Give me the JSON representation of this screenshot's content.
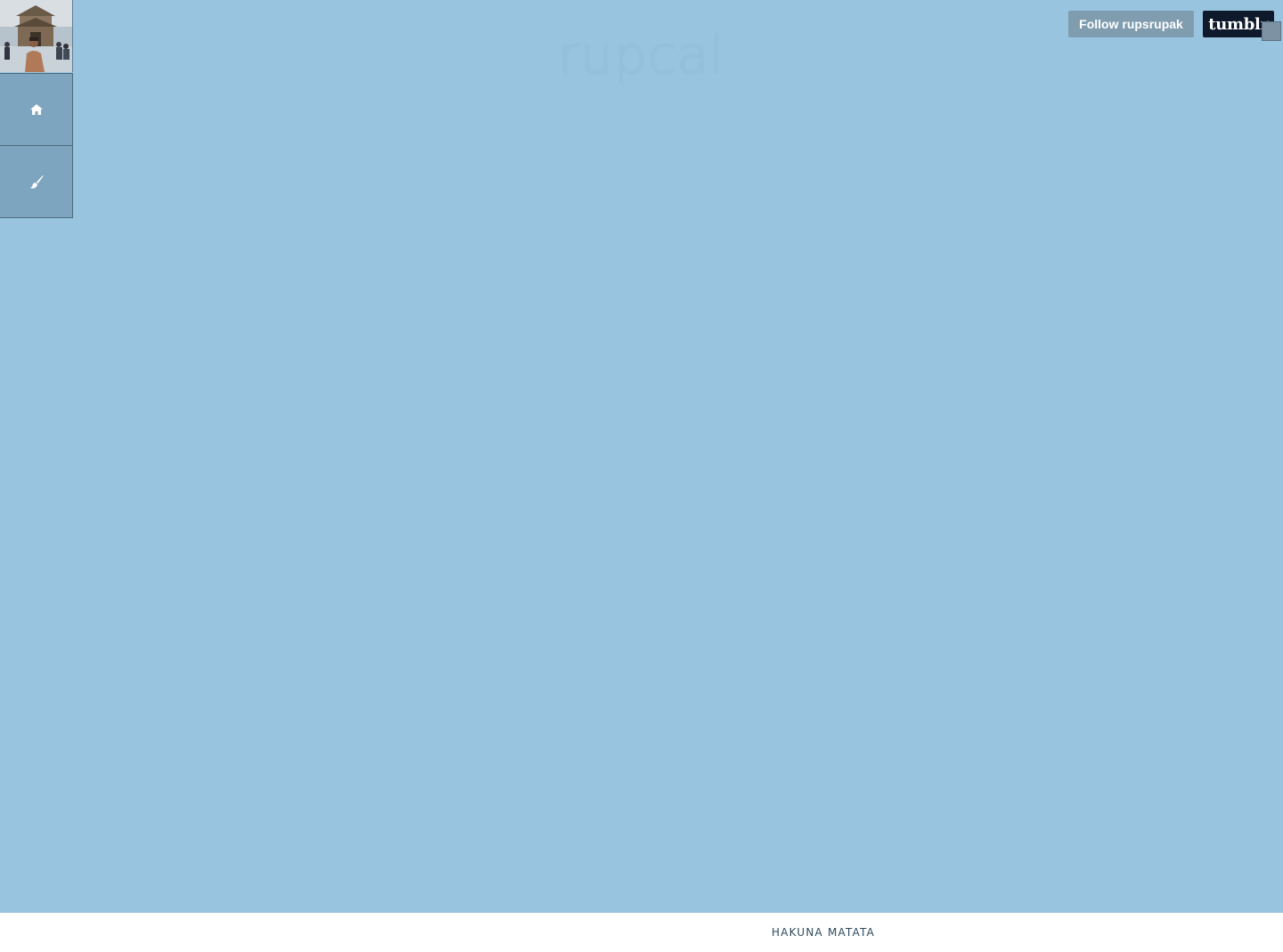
{
  "blog": {
    "title": "rupcal"
  },
  "sidebar": {
    "avatar_icon": "profile-photo",
    "items": [
      {
        "name": "home",
        "icon": "home-icon"
      },
      {
        "name": "theme",
        "icon": "paintbrush-icon"
      }
    ]
  },
  "header": {
    "follow_label": "Follow rupsrupak",
    "tumblr_label": "tumblr"
  },
  "footer": {
    "text": "HAKUNA MATATA"
  },
  "colors": {
    "background": "#98c4df",
    "sidebar_button": "#7ea5bf",
    "follow_button": "#7f9daf",
    "tumblr_button": "#0e1a2c",
    "footer_text": "#2e4a5e"
  }
}
